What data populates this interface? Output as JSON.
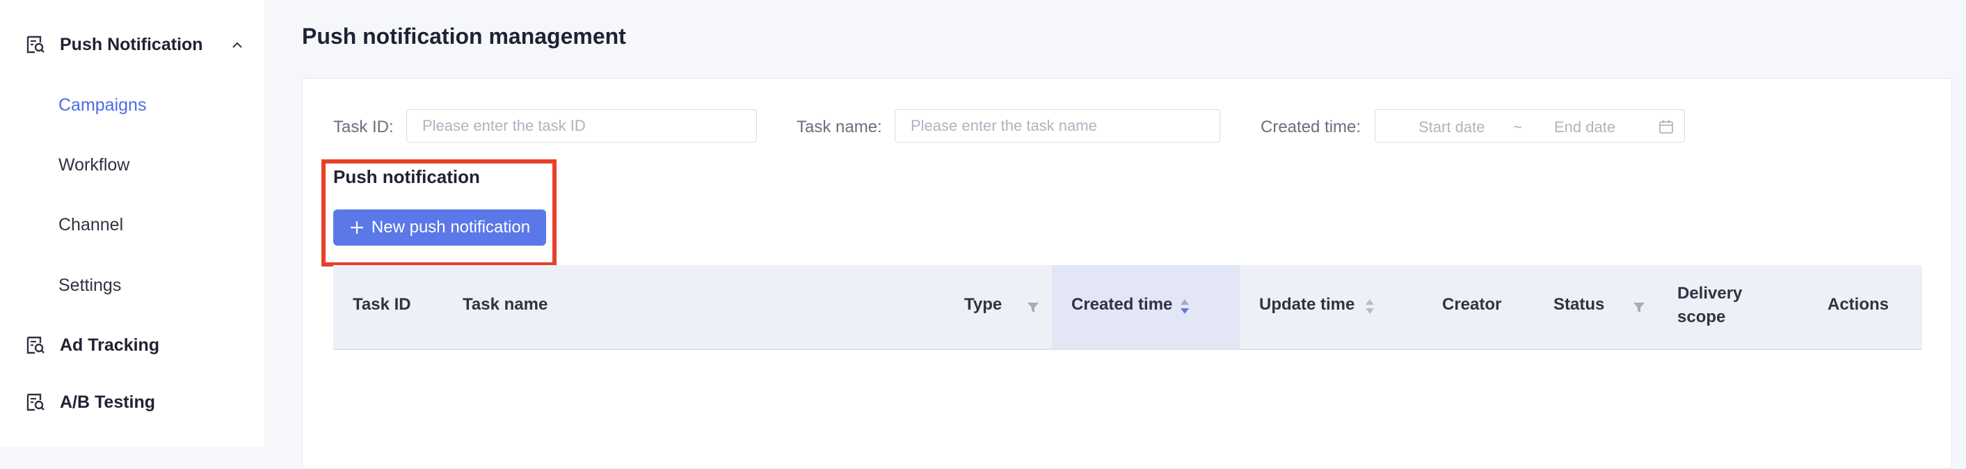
{
  "sidebar": {
    "group1_label": "Push Notification",
    "items": [
      {
        "label": "Campaigns"
      },
      {
        "label": "Workflow"
      },
      {
        "label": "Channel"
      },
      {
        "label": "Settings"
      }
    ],
    "group2_label": "Ad Tracking",
    "group3_label": "A/B Testing"
  },
  "page": {
    "title": "Push notification management"
  },
  "filters": {
    "task_id_label": "Task ID:",
    "task_id_placeholder": "Please enter the task ID",
    "task_name_label": "Task name:",
    "task_name_placeholder": "Please enter the task name",
    "created_label": "Created time:",
    "start_placeholder": "Start date",
    "separator": "~",
    "end_placeholder": "End date"
  },
  "section": {
    "title": "Push notification",
    "new_button_label": "New push notification"
  },
  "table": {
    "columns": {
      "task_id": "Task ID",
      "task_name": "Task name",
      "type": "Type",
      "created_time": "Created time",
      "update_time": "Update time",
      "creator": "Creator",
      "status": "Status",
      "delivery_line1": "Delivery",
      "delivery_line2": "scope",
      "actions": "Actions"
    }
  },
  "colors": {
    "accent": "#5a78e8",
    "active_link": "#4b6be6",
    "highlight": "#e8402a"
  }
}
